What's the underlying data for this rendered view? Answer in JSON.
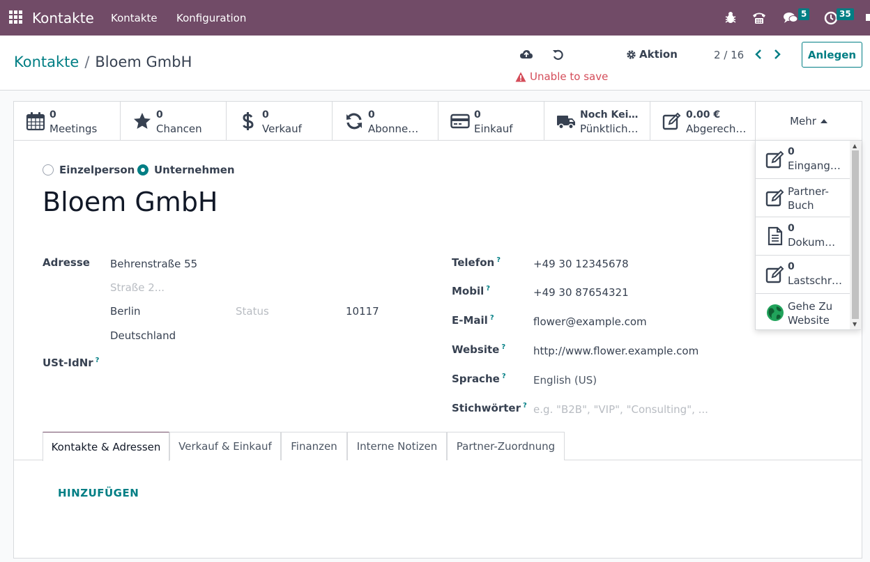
{
  "navbar": {
    "app_title": "Kontakte",
    "menu": [
      "Kontakte",
      "Konfiguration"
    ],
    "messages_count": "5",
    "activities_count": "35"
  },
  "breadcrumb": {
    "parent": "Kontakte",
    "separator": "/",
    "current": "Bloem GmbH"
  },
  "status": {
    "save_error": "Unable to save"
  },
  "toolbar": {
    "action_label": "Aktion",
    "pager": "2 / 16",
    "create_label": "Anlegen"
  },
  "smart_buttons": [
    {
      "value": "0",
      "label": "Meetings",
      "icon": "calendar-icon"
    },
    {
      "value": "0",
      "label": "Chancen",
      "icon": "star-icon"
    },
    {
      "value": "0",
      "label": "Verkauf",
      "icon": "dollar-icon"
    },
    {
      "value": "0",
      "label": "Abonne…",
      "icon": "refresh-icon"
    },
    {
      "value": "0",
      "label": "Einkauf",
      "icon": "credit-card-icon"
    },
    {
      "value": "Noch Kei…",
      "label": "Pünktlich…",
      "icon": "truck-icon"
    },
    {
      "value": "0.00 €",
      "label": "Abgerech…",
      "icon": "edit-icon"
    }
  ],
  "more": {
    "label": "Mehr",
    "items": [
      {
        "value": "0",
        "label": "Eingang…",
        "icon": "edit-icon"
      },
      {
        "value": "",
        "label": "Partner-\nBuch",
        "label_line1": "Partner-",
        "label_line2": "Buch",
        "icon": "edit-icon"
      },
      {
        "value": "0",
        "label": "Dokum…",
        "icon": "document-icon"
      },
      {
        "value": "0",
        "label": "Lastschr…",
        "icon": "edit-icon"
      },
      {
        "value": "",
        "label_line1": "Gehe Zu",
        "label_line2": "Website",
        "icon": "globe-icon"
      }
    ]
  },
  "company_type": {
    "options": [
      "Einzelperson",
      "Unternehmen"
    ],
    "selected": "Unternehmen"
  },
  "partner_name": "Bloem GmbH",
  "address": {
    "label": "Adresse",
    "street": "Behrenstraße 55",
    "street2_placeholder": "Straße 2...",
    "city": "Berlin",
    "state_placeholder": "Status",
    "zip": "10117",
    "country": "Deutschland"
  },
  "vat": {
    "label": "USt-IdNr",
    "help": "?"
  },
  "contact_fields": [
    {
      "label": "Telefon",
      "help": "?",
      "value": "+49 30 12345678"
    },
    {
      "label": "Mobil",
      "help": "?",
      "value": "+49 30 87654321"
    },
    {
      "label": "E-Mail",
      "help": "?",
      "value": "flower@example.com"
    },
    {
      "label": "Website",
      "help": "?",
      "value": "http://www.flower.example.com"
    },
    {
      "label": "Sprache",
      "help": "?",
      "value": "English (US)"
    },
    {
      "label": "Stichwörter",
      "help": "?",
      "placeholder": "e.g. \"B2B\", \"VIP\", \"Consulting\", ..."
    }
  ],
  "tabs": [
    "Kontakte & Adressen",
    "Verkauf & Einkauf",
    "Finanzen",
    "Interne Notizen",
    "Partner-Zuordnung"
  ],
  "active_tab": "Kontakte & Adressen",
  "add_label": "HINZUFÜGEN",
  "colors": {
    "navbar": "#714b67",
    "accent": "#017e84",
    "error": "#d44c59"
  }
}
